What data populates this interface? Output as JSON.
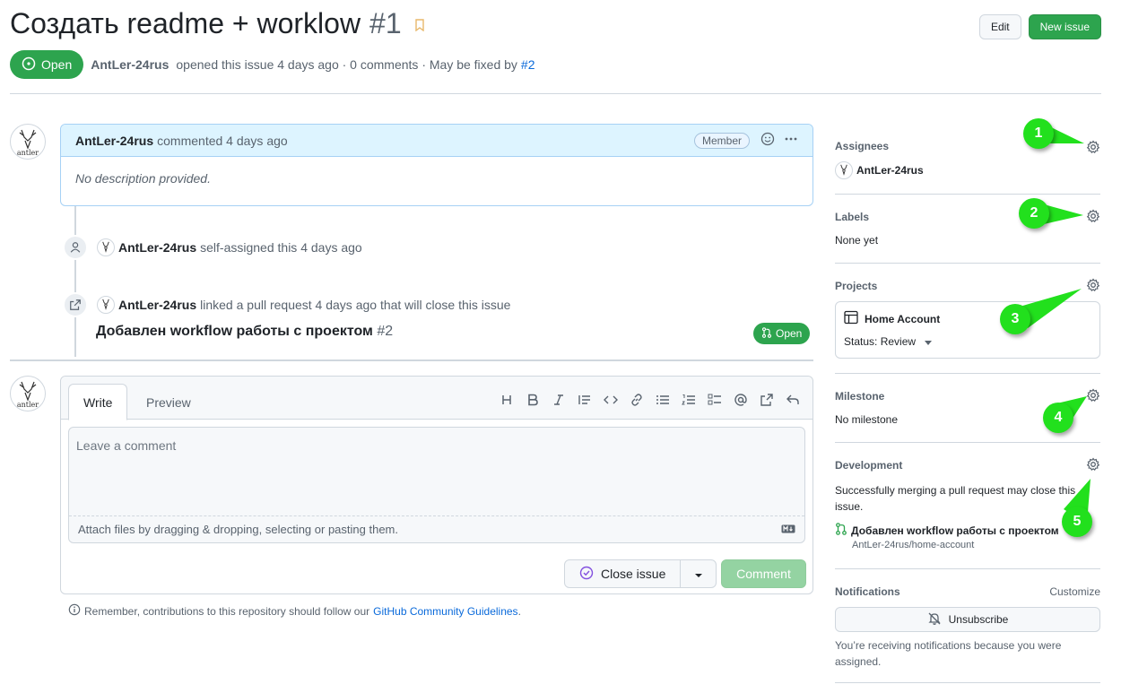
{
  "header": {
    "title": "Создать readme + worklow",
    "number": "#1",
    "edit_label": "Edit",
    "new_issue_label": "New issue"
  },
  "meta": {
    "state": "Open",
    "author": "AntLer-24rus",
    "opened_text": "opened this issue 4 days ago · 0 comments · May be fixed by",
    "fixed_by_link": "#2"
  },
  "comment": {
    "author": "AntLer-24rus",
    "action": "commented 4 days ago",
    "badge": "Member",
    "body": "No description provided."
  },
  "events": {
    "assigned": {
      "author": "AntLer-24rus",
      "text": "self-assigned this 4 days ago"
    },
    "linked": {
      "author": "AntLer-24rus",
      "text": "linked a pull request 4 days ago that will close this issue"
    },
    "pr_title": "Добавлен workflow работы с проектом",
    "pr_number": "#2",
    "pr_state": "Open"
  },
  "editor": {
    "tab_write": "Write",
    "tab_preview": "Preview",
    "placeholder": "Leave a comment",
    "attach_text": "Attach files by dragging & dropping, selecting or pasting them.",
    "close_issue": "Close issue",
    "comment_btn": "Comment",
    "remember_text": "Remember, contributions to this repository should follow our",
    "guidelines_link": "GitHub Community Guidelines",
    "period": "."
  },
  "sidebar": {
    "assignees_title": "Assignees",
    "assignee": "AntLer-24rus",
    "labels_title": "Labels",
    "labels_value": "None yet",
    "projects_title": "Projects",
    "project_name": "Home Account",
    "project_status": "Status: Review",
    "milestone_title": "Milestone",
    "milestone_value": "No milestone",
    "development_title": "Development",
    "development_text": "Successfully merging a pull request may close this issue.",
    "dev_pr_title": "Добавлен workflow работы с проектом",
    "dev_repo": "AntLer-24rus/home-account",
    "notifications_title": "Notifications",
    "customize": "Customize",
    "unsubscribe": "Unsubscribe",
    "notif_reason": "You’re receiving notifications because you were assigned."
  },
  "markers": [
    "1",
    "2",
    "3",
    "4",
    "5"
  ],
  "colors": {
    "open_green": "#2da44e",
    "marker_green": "#22e01d",
    "link_blue": "#0969da",
    "comment_header_bg": "#ddf4ff"
  }
}
